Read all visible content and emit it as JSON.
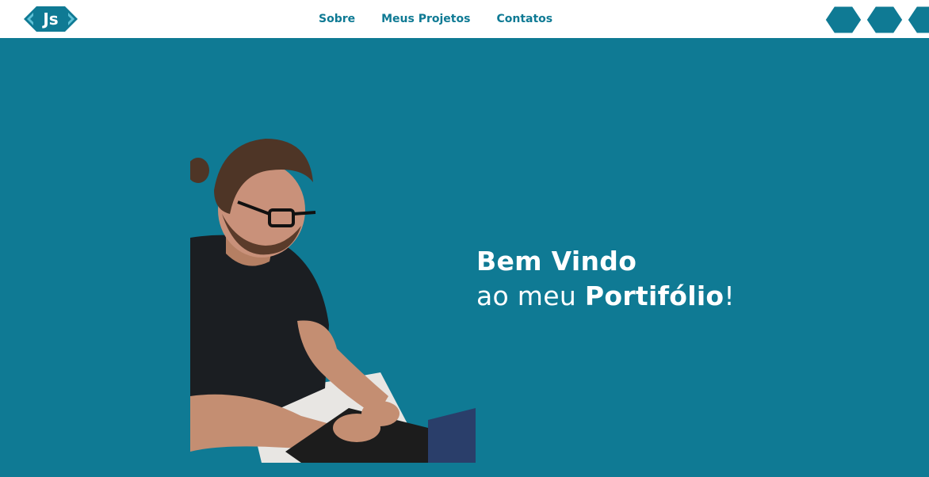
{
  "header": {
    "logo_text": "Js",
    "nav": [
      "Sobre",
      "Meus Projetos",
      "Contatos"
    ]
  },
  "hero": {
    "line1": "Bem Vindo",
    "line2_prefix": "ao meu ",
    "line2_bold": "Portifólio",
    "line2_suffix": "!"
  },
  "colors": {
    "primary": "#0f7a94",
    "header_bg": "#ffffff",
    "text_light": "#ffffff"
  }
}
